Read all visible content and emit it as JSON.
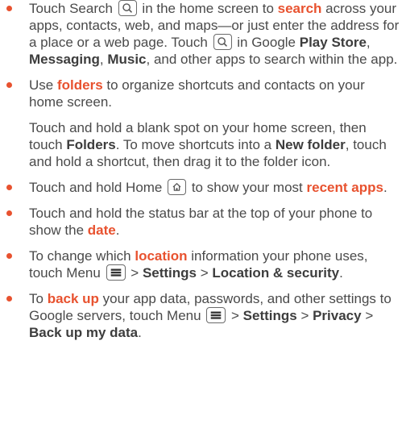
{
  "tips": {
    "search": {
      "t1": "Touch Search ",
      "t2": " in the home screen to ",
      "hl1": "search",
      "t3": " across your apps, contacts, web, and maps—or just enter the address for a place or a web page. Touch ",
      "t4": " in Google ",
      "b1": "Play Store",
      "t5": ", ",
      "b2": "Messaging",
      "t6": ", ",
      "b3": "Music",
      "t7": ", and other apps to search within the app.",
      "icon": "search-icon"
    },
    "folders": {
      "t1": "Use ",
      "hl1": "folders",
      "t2": " to organize shortcuts and contacts on your home screen.",
      "p2_t1": "Touch and hold a blank spot on your home screen, then touch ",
      "p2_b1": "Folders",
      "p2_t2": ". To move shortcuts into a ",
      "p2_b2": "New folder",
      "p2_t3": ", touch and hold a shortcut, then drag it to the folder icon."
    },
    "recent": {
      "t1": "Touch and hold Home ",
      "t2": " to show your most ",
      "hl1": "recent apps",
      "t3": ".",
      "icon": "home-icon"
    },
    "date": {
      "t1": "Touch and hold the status bar at the top of your phone to show the ",
      "hl1": "date",
      "t2": "."
    },
    "location": {
      "t1": "To change which ",
      "hl1": "location",
      "t2": " information your phone uses, touch Menu ",
      "t3": " > ",
      "b1": "Settings",
      "t4": " > ",
      "b2": "Location & security",
      "t5": ".",
      "icon": "menu-icon"
    },
    "backup": {
      "t1": "To ",
      "hl1": "back up",
      "t2": " your app data, passwords, and other settings to Google servers, touch Menu ",
      "t3": " > ",
      "b1": "Settings",
      "t4": " > ",
      "b2": "Privacy",
      "t5": " > ",
      "b3": "Back up my data",
      "t6": ".",
      "icon": "menu-icon"
    }
  },
  "colors": {
    "accent": "#e8522f",
    "text": "#4a4a4a"
  }
}
